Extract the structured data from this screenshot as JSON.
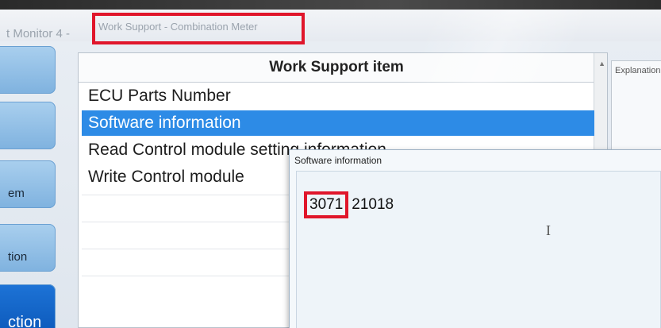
{
  "window": {
    "title_prefix": "t Monitor 4 -",
    "title_highlighted": "Work Support - Combination Meter"
  },
  "leftnav": {
    "items": [
      {
        "label": ""
      },
      {
        "label": ""
      },
      {
        "label": "em"
      },
      {
        "label": "tion"
      },
      {
        "label": "ction",
        "active": true
      }
    ]
  },
  "list": {
    "header": "Work Support item",
    "rows": [
      {
        "label": "ECU Parts Number",
        "selected": false
      },
      {
        "label": "Software information",
        "selected": true
      },
      {
        "label": "Read Control module setting information",
        "selected": false
      },
      {
        "label": "Write Control module",
        "selected": false
      }
    ]
  },
  "explanation": {
    "title": "Explanation"
  },
  "popup": {
    "title": "Software information",
    "code_highlight": "3071",
    "code_rest": "21018"
  },
  "colors": {
    "highlight_red": "#e0162b",
    "selected_blue": "#2d8be6",
    "nav_active_blue": "#0a56b8"
  }
}
